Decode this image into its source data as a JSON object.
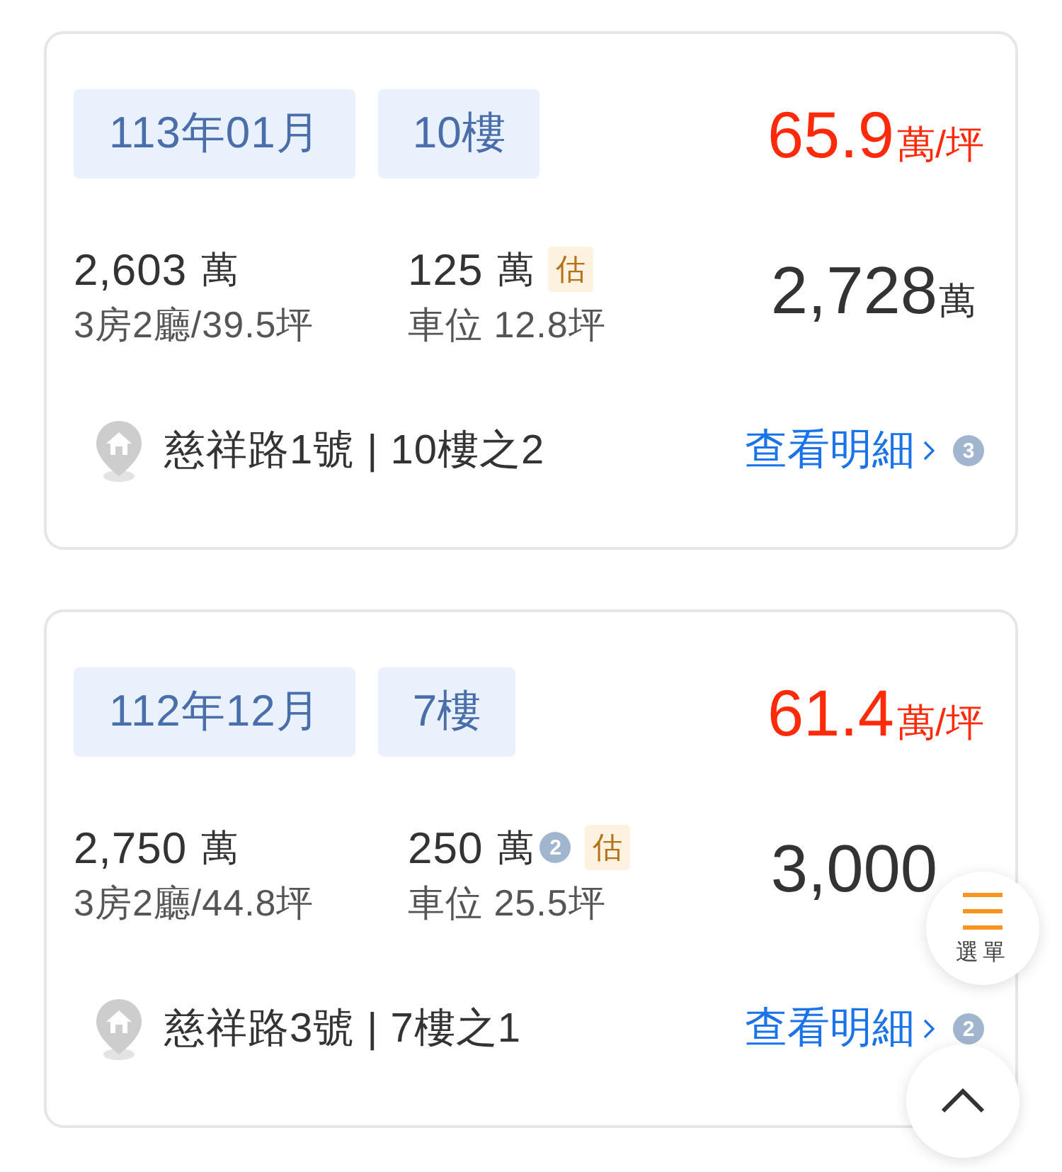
{
  "listings": [
    {
      "date": "113年01月",
      "floor": "10樓",
      "unit_price": "65.9",
      "unit_price_unit": "萬/坪",
      "house_price": "2,603",
      "house_price_unit": "萬",
      "layout": "3房2廳/39.5坪",
      "parking_price": "125",
      "parking_price_unit": "萬",
      "estimate_tag": "估",
      "parking_size": "車位 12.8坪",
      "total_price": "2,728",
      "total_price_unit": "萬",
      "address": "慈祥路1號 | 10樓之2",
      "details_link": "查看明細",
      "details_count": "3"
    },
    {
      "date": "112年12月",
      "floor": "7樓",
      "unit_price": "61.4",
      "unit_price_unit": "萬/坪",
      "house_price": "2,750",
      "house_price_unit": "萬",
      "layout": "3房2廳/44.8坪",
      "parking_price": "250",
      "parking_price_unit": "萬",
      "parking_count": "2",
      "estimate_tag": "估",
      "parking_size": "車位 25.5坪",
      "total_price": "3,000",
      "address": "慈祥路3號 | 7樓之1",
      "details_link": "查看明細",
      "details_count": "2"
    }
  ],
  "menu_button": {
    "label": "選單"
  }
}
